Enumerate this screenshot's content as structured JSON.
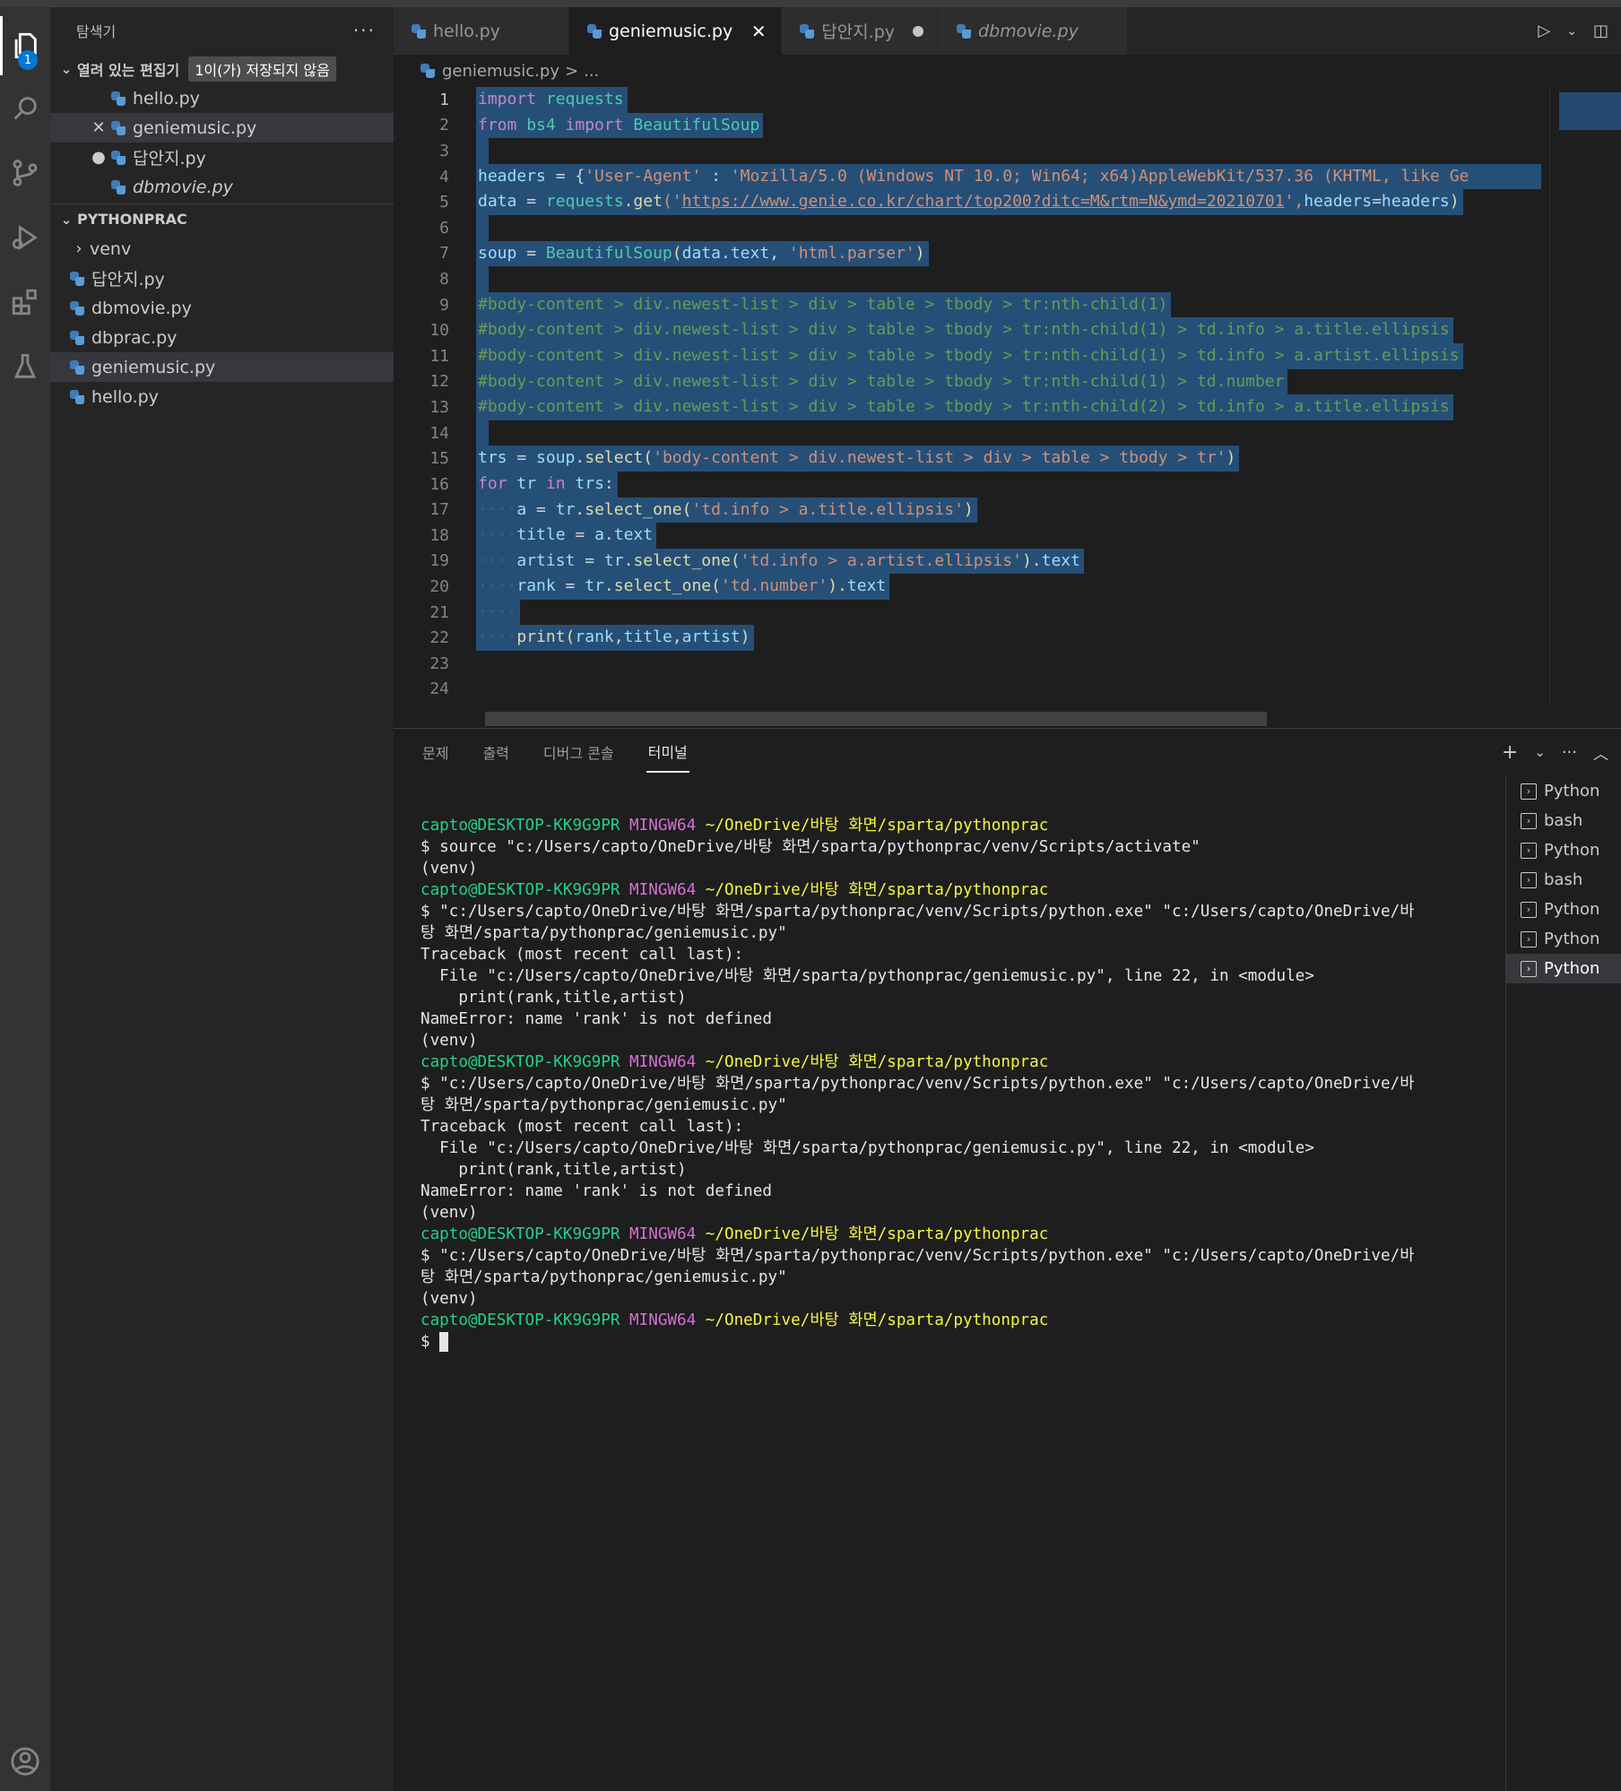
{
  "sidebar": {
    "title": "탐색기",
    "more": "···",
    "open_editors": {
      "title": "열려 있는 편집기",
      "dirty_badge": "1이(가) 저장되지 않음",
      "items": [
        {
          "label": "hello.py",
          "lead": ""
        },
        {
          "label": "geniemusic.py",
          "lead": "✕"
        },
        {
          "label": "답안지.py",
          "lead": "●"
        },
        {
          "label": "dbmovie.py",
          "lead": ""
        }
      ]
    },
    "project": {
      "title": "PYTHONPRAC",
      "folder": "venv",
      "files": [
        "답안지.py",
        "dbmovie.py",
        "dbprac.py",
        "geniemusic.py",
        "hello.py"
      ]
    }
  },
  "activity_badge": "1",
  "tabs": [
    {
      "label": "hello.py"
    },
    {
      "label": "geniemusic.py",
      "close": "✕"
    },
    {
      "label": "답안지.py"
    },
    {
      "label": "dbmovie.py"
    }
  ],
  "breadcrumb": {
    "file": "geniemusic.py",
    "sep": ">",
    "rest": "..."
  },
  "code": {
    "line_numbers": [
      "1",
      "2",
      "3",
      "4",
      "5",
      "6",
      "7",
      "8",
      "9",
      "10",
      "11",
      "12",
      "13",
      "14",
      "15",
      "16",
      "17",
      "18",
      "19",
      "20",
      "21",
      "22",
      "23",
      "24"
    ],
    "l1a": "import",
    "l1b": " requests",
    "l2a": "from",
    "l2b": " bs4 ",
    "l2c": "import",
    "l2d": " BeautifulSoup",
    "l4a": "headers",
    "l4b": " = {",
    "l4c": "'User-Agent'",
    "l4d": " : ",
    "l4e": "'Mozilla/5.0 (Windows NT 10.0; Win64; x64)AppleWebKit/537.36 (KHTML, like Ge",
    "l5a": "data",
    "l5b": " = ",
    "l5c": "requests",
    "l5d": ".",
    "l5e": "get",
    "l5f": "('",
    "l5g": "https://www.genie.co.kr/chart/top200?ditc=M&rtm=N&ymd=20210701",
    "l5h": "',",
    "l5i": "headers",
    "l5j": "=",
    "l5k": "headers",
    "l5l": ")",
    "l7a": "soup",
    "l7b": " = ",
    "l7c": "BeautifulSoup",
    "l7d": "(",
    "l7e": "data",
    "l7f": ".",
    "l7g": "text",
    "l7h": ", ",
    "l7i": "'html.parser'",
    "l7j": ")",
    "l9": "#body-content > div.newest-list > div > table > tbody > tr:nth-child(1)",
    "l10": "#body-content > div.newest-list > div > table > tbody > tr:nth-child(1) > td.info > a.title.ellipsis",
    "l11": "#body-content > div.newest-list > div > table > tbody > tr:nth-child(1) > td.info > a.artist.ellipsis",
    "l12": "#body-content > div.newest-list > div > table > tbody > tr:nth-child(1) > td.number",
    "l13": "#body-content > div.newest-list > div > table > tbody > tr:nth-child(2) > td.info > a.title.ellipsis",
    "l15a": "trs",
    "l15b": " = ",
    "l15c": "soup",
    "l15d": ".",
    "l15e": "select",
    "l15f": "(",
    "l15g": "'body-content > div.newest-list > div > table > tbody > tr'",
    "l15h": ")",
    "l16a": "for",
    "l16b": " tr ",
    "l16c": "in",
    "l16d": " trs",
    "l16e": ":",
    "indent": "····",
    "l17a": "a",
    "l17b": " = ",
    "l17c": "tr",
    "l17d": ".",
    "l17e": "select_one",
    "l17f": "(",
    "l17g": "'td.info > a.title.ellipsis'",
    "l17h": ")",
    "l18a": "title",
    "l18b": " = ",
    "l18c": "a",
    "l18d": ".",
    "l18e": "text",
    "l19a": "artist",
    "l19b": " = ",
    "l19c": "tr",
    "l19d": ".",
    "l19e": "select_one",
    "l19f": "(",
    "l19g": "'td.info > a.artist.ellipsis'",
    "l19h": ").",
    "l19i": "text",
    "l20a": "rank",
    "l20b": " = ",
    "l20c": "tr",
    "l20d": ".",
    "l20e": "select_one",
    "l20f": "(",
    "l20g": "'td.number'",
    "l20h": ").",
    "l20i": "text",
    "l22a": "print",
    "l22b": "(",
    "l22c": "rank",
    "l22d": ",",
    "l22e": "title",
    "l22f": ",",
    "l22g": "artist",
    "l22h": ")"
  },
  "panel": {
    "tabs": [
      "문제",
      "출력",
      "디버그 콘솔",
      "터미널"
    ],
    "prompt_user": "capto@DESKTOP-KK9G9PR",
    "prompt_ming": "MINGW64",
    "prompt_path": "~/OneDrive/바탕 화면/sparta/pythonprac",
    "lines": {
      "source": "$ source \"c:/Users/capto/OneDrive/바탕 화면/sparta/pythonprac/venv/Scripts/activate\"",
      "venv": "(venv)",
      "run1": "$ \"c:/Users/capto/OneDrive/바탕 화면/sparta/pythonprac/venv/Scripts/python.exe\" \"c:/Users/capto/OneDrive/바",
      "run2": "탕 화면/sparta/pythonprac/geniemusic.py\"",
      "tb": "Traceback (most recent call last):",
      "file": "  File \"c:/Users/capto/OneDrive/바탕 화면/sparta/pythonprac/geniemusic.py\", line 22, in <module>",
      "print": "    print(rank,title,artist)",
      "err": "NameError: name 'rank' is not defined",
      "dollar": "$ "
    },
    "terminals": [
      "Python",
      "bash",
      "Python",
      "bash",
      "Python",
      "Python",
      "Python"
    ]
  }
}
